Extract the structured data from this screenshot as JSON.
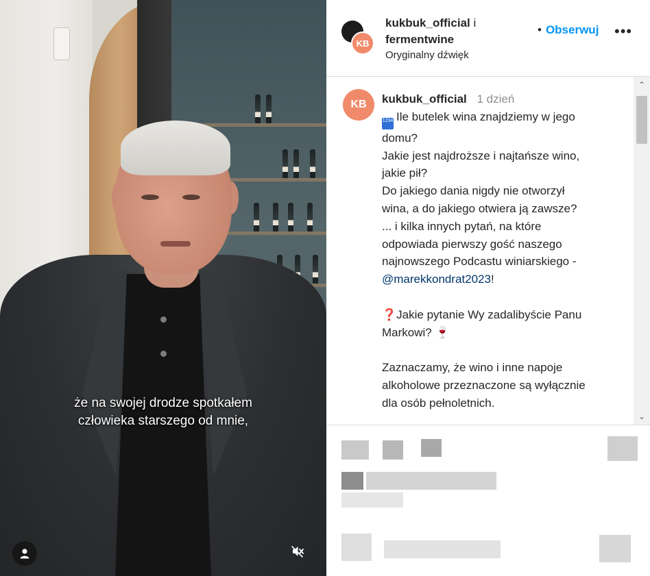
{
  "video": {
    "subtitle_lines": [
      "że na swojej drodze spotkałem",
      "człowieka starszego od mnie,"
    ],
    "user_tag_icon": "person-icon",
    "mute_icon": "speaker-muted-icon"
  },
  "header": {
    "account_primary": "kukbuk_official",
    "connector": " i",
    "account_secondary": "fermentwine",
    "audio_label": "Oryginalny dźwięk",
    "bullet": "•",
    "follow_label": "Obserwuj",
    "more_label": "•••",
    "avatar_text": "KB"
  },
  "caption": {
    "avatar_text": "KB",
    "username": "kukbuk_official",
    "time": "1 dzień",
    "number_emoji": "1234",
    "lines": {
      "l1": "Ile butelek wina znajdziemy w jego",
      "l2": "domu?",
      "l3": "Jakie jest najdroższe i najtańsze wino,",
      "l4": "jakie pił?",
      "l5": "Do jakiego dania nigdy nie otworzył",
      "l6": "wina, a do jakiego otwiera ją zawsze?",
      "l7": "... i kilka innych pytań, na które",
      "l8": "odpowiada pierwszy gość naszego",
      "l9": "najnowszego Podcastu winiarskiego -",
      "mention": "@marekkondrat2023",
      "mention_tail": "!",
      "q_emoji": "❓",
      "l10": "Jakie pytanie Wy zadalibyście Panu",
      "l11": "Markowi?",
      "wine_emoji": "🍷",
      "l12": "Zaznaczamy, że wino i inne napoje",
      "l13": "alkoholowe przeznaczone są wyłącznie",
      "l14": "dla osób pełnoletnich."
    }
  },
  "scrollbar": {
    "up_glyph": "⌃",
    "down_glyph": "⌄"
  },
  "colors": {
    "follow": "#0095f6",
    "mention": "#00376b",
    "avatar": "#f08a6b"
  }
}
